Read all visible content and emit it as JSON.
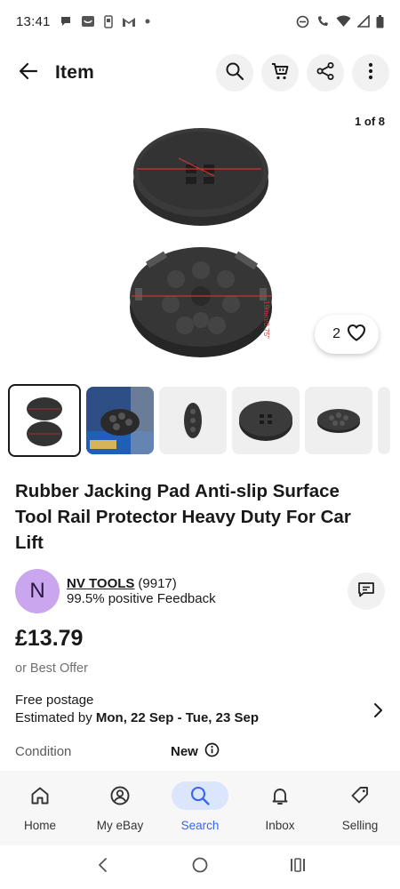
{
  "status_bar": {
    "time": "13:41",
    "left_icons": [
      "chat-bubble-icon",
      "ebay-notification-icon",
      "phone-storage-icon",
      "gmail-icon",
      "dot-icon"
    ],
    "right_icons": [
      "do-not-disturb-icon",
      "wifi-calling-icon",
      "wifi-icon",
      "signal-icon",
      "battery-icon"
    ]
  },
  "app_bar": {
    "title": "Item",
    "back_icon": "arrow-left-icon",
    "actions": [
      "search-icon",
      "cart-icon",
      "share-icon",
      "more-vert-icon"
    ]
  },
  "gallery": {
    "counter": "1 of 8",
    "watch_count": "2",
    "image_labels": [
      "19mm/0.75\""
    ],
    "thumbnail_count": 6
  },
  "product": {
    "title": "Rubber Jacking Pad Anti-slip Surface Tool Rail Protector Heavy Duty For Car Lift",
    "price": "£13.79",
    "best_offer": "or Best Offer"
  },
  "seller": {
    "initial": "N",
    "name": "NV TOOLS",
    "count": "(9917)",
    "feedback": "99.5% positive Feedback"
  },
  "shipping": {
    "line1": "Free postage",
    "prefix": "Estimated by",
    "dates": "Mon, 22 Sep - Tue, 23 Sep"
  },
  "condition": {
    "label": "Condition",
    "value": "New"
  },
  "bottom_nav": {
    "items": [
      {
        "label": "Home",
        "icon": "home-icon"
      },
      {
        "label": "My eBay",
        "icon": "account-icon"
      },
      {
        "label": "Search",
        "icon": "search-icon"
      },
      {
        "label": "Inbox",
        "icon": "bell-icon"
      },
      {
        "label": "Selling",
        "icon": "tag-icon"
      }
    ],
    "active": "Search"
  },
  "colors": {
    "accent": "#3665f3",
    "avatar": "#c9a6ee",
    "active_nav_bg": "#dbe5fb",
    "text": "#191919"
  }
}
